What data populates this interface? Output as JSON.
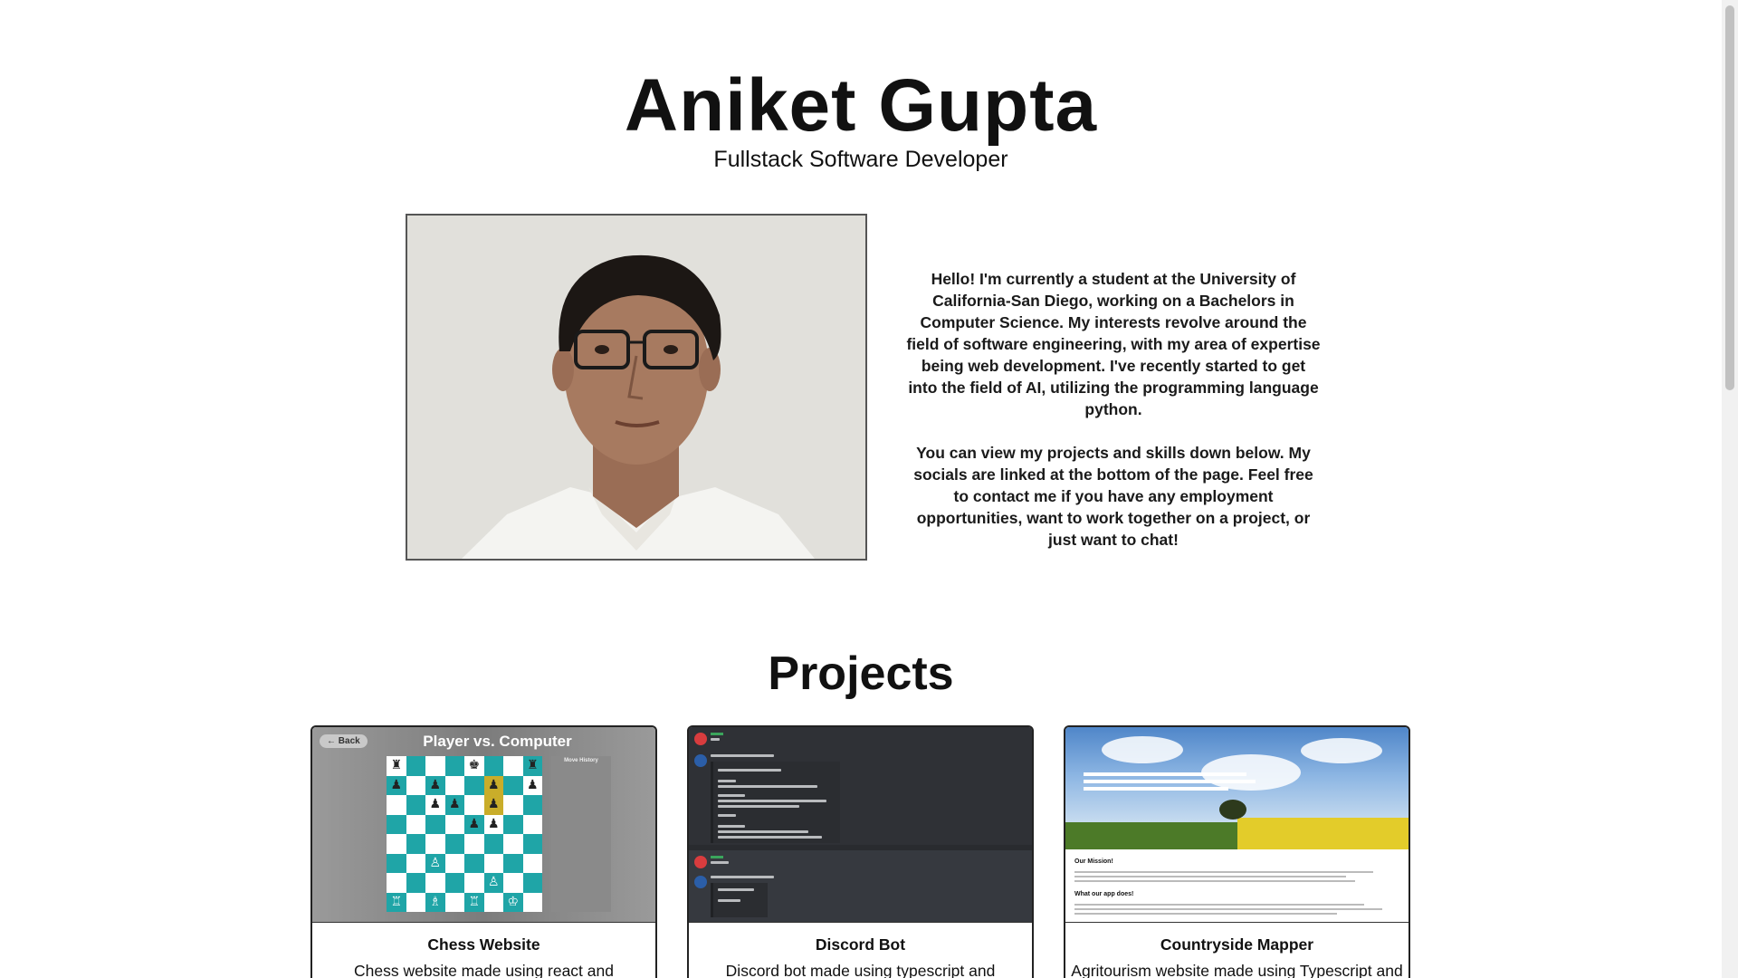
{
  "header": {
    "name": "Aniket Gupta",
    "role": "Fullstack Software Developer"
  },
  "bio": {
    "paragraph1": "Hello! I'm currently a student at the University of California-San Diego, working on a Bachelors in Computer Science. My interests revolve around the field of software engineering, with my area of expertise being web development. I've recently started to get into the field of AI, utilizing the programming language python.",
    "paragraph2": "You can view my projects and skills down below. My socials are linked at the bottom of the page. Feel free to contact me if you have any employment opportunities, want to work together on a project, or just want to chat!"
  },
  "projects": {
    "title": "Projects",
    "items": [
      {
        "title": "Chess Website",
        "description": "Chess website made using react and typescript.",
        "thumb_heading": "Player vs. Computer",
        "thumb_back": "Back",
        "thumb_moves_heading": "Move History"
      },
      {
        "title": "Discord Bot",
        "description": "Discord bot made using typescript and discord.js."
      },
      {
        "title": "Countryside Mapper",
        "description": "Agritourism website made using Typescript and",
        "thumb_sections": [
          "Our Mission!",
          "What our app does!"
        ]
      }
    ]
  },
  "colors": {
    "chess_light": "#ffffff",
    "chess_dark": "#1fa5a7",
    "chess_highlight": "#c9ad2a",
    "discord_bg": "#36393f"
  }
}
